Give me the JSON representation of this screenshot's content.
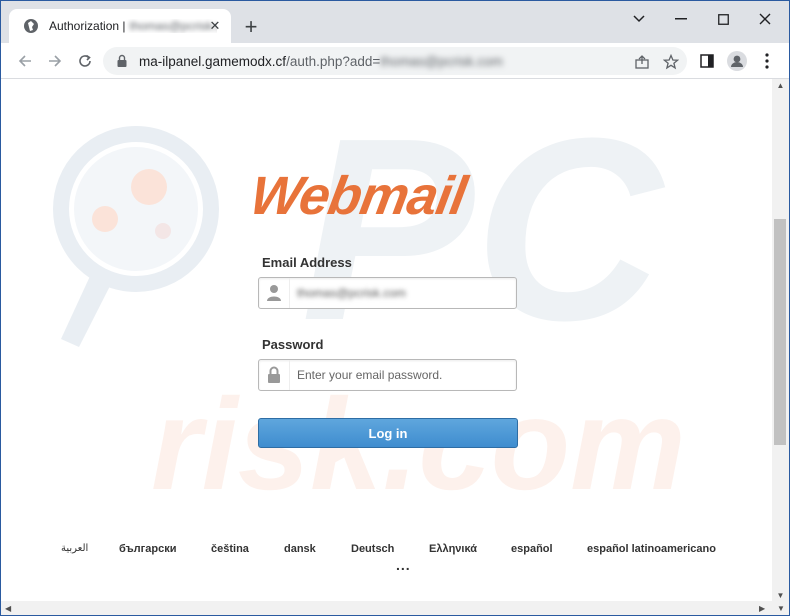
{
  "browser": {
    "tab": {
      "title": "Authorization |",
      "title_blurred": "thomas@pcrisk.com",
      "close_icon": "close-icon",
      "favicon": "globe-icon"
    },
    "new_tab_icon": "plus-icon",
    "window_controls": [
      "chevron-down-icon",
      "minimize-icon",
      "maximize-icon",
      "close-icon"
    ],
    "address_bar": {
      "domain": "ma-ilpanel.gamemodx.cf",
      "path": "/auth.php?add=",
      "blurred_param": "thomas@pcrisk.com"
    },
    "toolbar_icons": [
      "back-icon",
      "forward-icon",
      "lock-icon",
      "share-icon",
      "star-icon",
      "sidebar-icon",
      "profile-icon",
      "menu-icon"
    ]
  },
  "page": {
    "logo_text": "Webmail",
    "logo_color": "#e8733a",
    "email": {
      "label": "Email Address",
      "value": "thomas@pcrisk.com"
    },
    "password": {
      "label": "Password",
      "placeholder": "Enter your email password."
    },
    "login_label": "Log in",
    "languages": [
      "العربية",
      "български",
      "čeština",
      "dansk",
      "Deutsch",
      "Ελληνικά",
      "español",
      "español latinoamericano"
    ],
    "more_label": "..."
  },
  "colors": {
    "accent_button": "#4a95d6",
    "watermark": "#eef2f6"
  }
}
